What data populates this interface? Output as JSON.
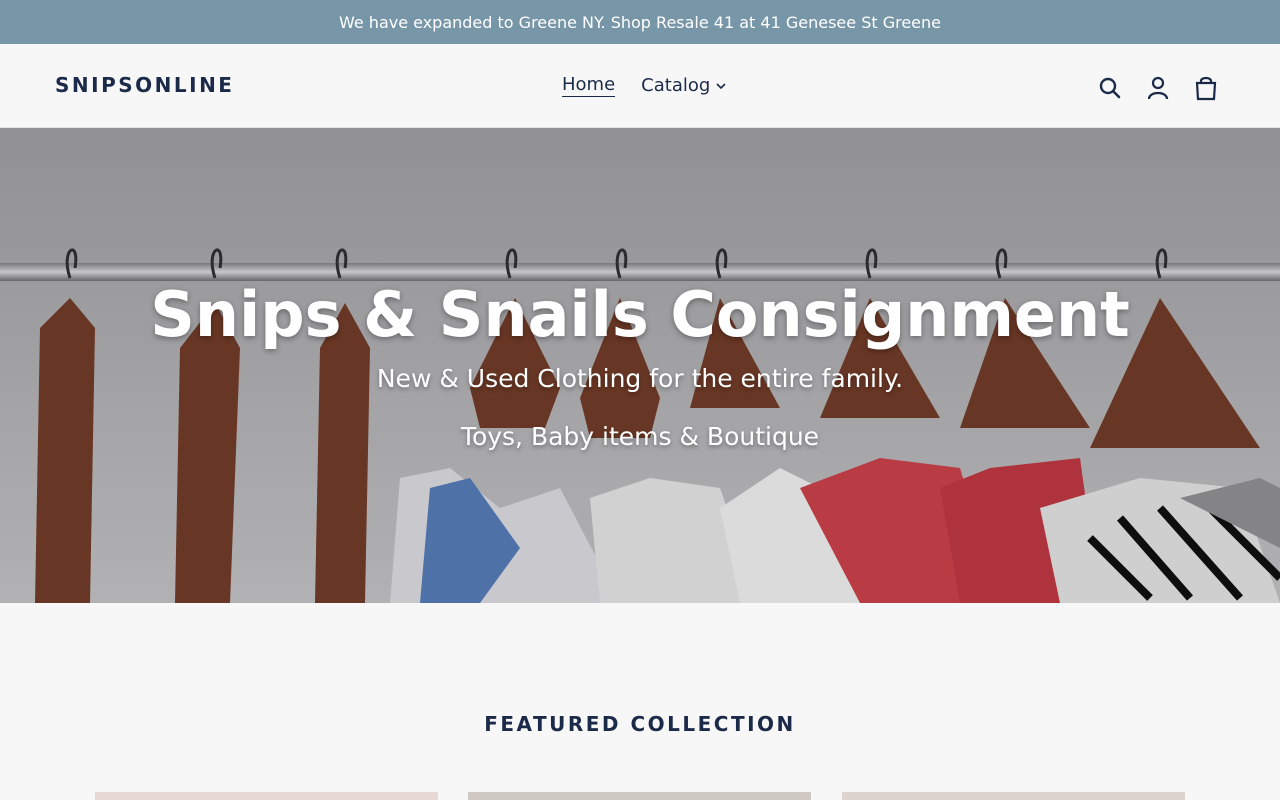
{
  "announcement": {
    "text": "We have expanded to Greene NY. Shop Resale 41 at 41 Genesee St Greene"
  },
  "header": {
    "logo": "SNIPSONLINE",
    "nav": {
      "home": "Home",
      "catalog": "Catalog"
    },
    "icons": [
      "search-icon",
      "account-icon",
      "cart-icon"
    ]
  },
  "hero": {
    "title": "Snips & Snails Consignment",
    "subtitle1": "New & Used Clothing for the entire family.",
    "subtitle2": "Toys, Baby items & Boutique"
  },
  "featured": {
    "title": "FEATURED COLLECTION"
  },
  "colors": {
    "announcement_bg": "#7796a8",
    "text_navy": "#1c2a4a",
    "page_bg": "#f7f7f7"
  }
}
